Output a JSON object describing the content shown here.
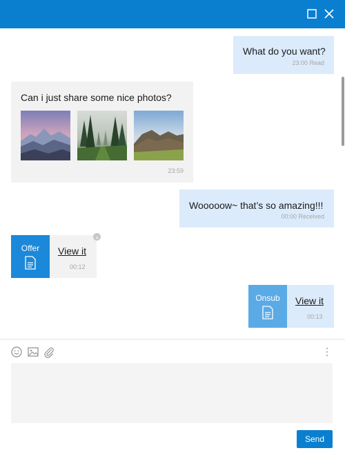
{
  "window": {
    "maximize_icon": "maximize-icon",
    "close_icon": "close-icon",
    "accent_color": "#0a7fd0"
  },
  "messages": [
    {
      "direction": "outgoing",
      "text": "What do you want?",
      "meta": "23:00 Read"
    },
    {
      "direction": "incoming",
      "text": "Can i just share some nice photos?",
      "meta": "23:59",
      "photos": [
        "mountain-sunset",
        "misty-forest",
        "green-hills"
      ]
    },
    {
      "direction": "outgoing",
      "text": "Wooooow~ that’s so amazing!!!",
      "meta": "00:00 Received"
    },
    {
      "direction": "incoming",
      "card_title": "Offer",
      "link": "View it",
      "meta": "00:12",
      "status_icon": "clock-icon"
    },
    {
      "direction": "outgoing",
      "card_title": "Onsub",
      "link": "View it",
      "meta": "00:13"
    }
  ],
  "composer": {
    "tools": [
      "emoji-icon",
      "image-icon",
      "attach-icon"
    ],
    "more_icon": "more-vertical-icon",
    "input_value": "",
    "send_label": "Send"
  }
}
